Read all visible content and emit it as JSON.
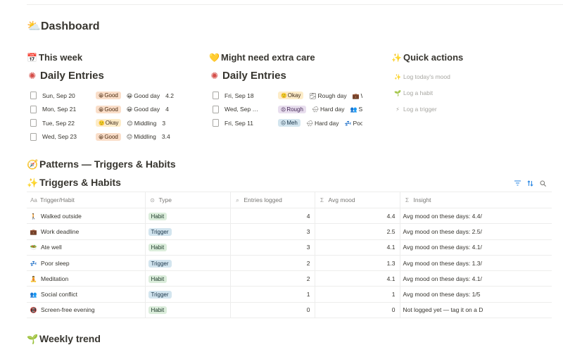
{
  "dashboard": {
    "icon": "⛅",
    "title": "Dashboard"
  },
  "colors": {
    "good_bg": "#fadec9",
    "good_text": "#49290e",
    "okay_bg": "#fdecc8",
    "okay_text": "#402c1b",
    "rough_bg": "#e8deee",
    "rough_text": "#412454",
    "meh_bg": "#d3e5ef",
    "meh_text": "#183347",
    "habit_bg": "#dbeddb",
    "trigger_bg": "#d3e5ef"
  },
  "this_week": {
    "icon": "📅",
    "heading": "This week",
    "view_icon": "✺",
    "view_title": "Daily Entries",
    "rows": [
      {
        "date": "Sun, Sep 20",
        "mood": "Good",
        "mood_icon": "😀",
        "day": "Good day",
        "day_icon": "😀",
        "score": "4.2"
      },
      {
        "date": "Mon, Sep 21",
        "mood": "Good",
        "mood_icon": "😀",
        "day": "Good day",
        "day_icon": "😀",
        "score": "4"
      },
      {
        "date": "Tue, Sep 22",
        "mood": "Okay",
        "mood_icon": "🙂",
        "day": "Middling",
        "day_icon": "😐",
        "score": "3"
      },
      {
        "date": "Wed, Sep 23",
        "mood": "Good",
        "mood_icon": "😀",
        "day": "Middling",
        "day_icon": "😐",
        "score": "3.4"
      }
    ]
  },
  "extra_care": {
    "icon": "💛",
    "heading": "Might need extra care",
    "view_icon": "✺",
    "view_title": "Daily Entries",
    "rows": [
      {
        "date": "Fri, Sep 18",
        "mood": "Okay",
        "mood_icon": "🙂",
        "day": "Rough day",
        "day_icon": "🌫",
        "tag": "Wor",
        "tag_icon": "💼"
      },
      {
        "date": "Wed, Sep …",
        "mood": "Rough",
        "mood_icon": "😣",
        "day": "Hard day",
        "day_icon": "🌧",
        "tag": "Soci",
        "tag_icon": "👥"
      },
      {
        "date": "Fri, Sep 11",
        "mood": "Meh",
        "mood_icon": "😐",
        "day": "Hard day",
        "day_icon": "🌧",
        "tag": "Poor s",
        "tag_icon": "💤"
      }
    ]
  },
  "quick_actions": {
    "icon": "✨",
    "heading": "Quick actions",
    "items": [
      {
        "icon": "✨",
        "label": "Log today's mood"
      },
      {
        "icon": "🌱",
        "label": "Log a habit"
      },
      {
        "icon": "⚡",
        "label": "Log a trigger"
      }
    ]
  },
  "patterns": {
    "icon": "🧭",
    "title": "Patterns — Triggers & Habits"
  },
  "triggers_habits": {
    "icon": "✨",
    "title": "Triggers & Habits",
    "toolbar": {
      "filter": "filter-icon",
      "sort": "sort-icon",
      "search": "search-icon"
    },
    "columns": [
      {
        "icon": "Aa",
        "label": "Trigger/Habit"
      },
      {
        "icon": "⊙",
        "label": "Type"
      },
      {
        "icon": "⌕",
        "label": "Entries logged"
      },
      {
        "icon": "Σ",
        "label": "Avg mood"
      },
      {
        "icon": "Σ",
        "label": "Insight"
      }
    ],
    "rows": [
      {
        "icon": "🚶",
        "name": "Walked outside",
        "type": "Habit",
        "entries": "4",
        "avg": "4.4",
        "insight": "Avg mood on these days: 4.4/"
      },
      {
        "icon": "💼",
        "name": "Work deadline",
        "type": "Trigger",
        "entries": "3",
        "avg": "2.5",
        "insight": "Avg mood on these days: 2.5/"
      },
      {
        "icon": "🥗",
        "name": "Ate well",
        "type": "Habit",
        "entries": "3",
        "avg": "4.1",
        "insight": "Avg mood on these days: 4.1/"
      },
      {
        "icon": "💤",
        "name": "Poor sleep",
        "type": "Trigger",
        "entries": "2",
        "avg": "1.3",
        "insight": "Avg mood on these days: 1.3/"
      },
      {
        "icon": "🧘",
        "name": "Meditation",
        "type": "Habit",
        "entries": "2",
        "avg": "4.1",
        "insight": "Avg mood on these days: 4.1/"
      },
      {
        "icon": "👥",
        "name": "Social conflict",
        "type": "Trigger",
        "entries": "1",
        "avg": "1",
        "insight": "Avg mood on these days: 1/5"
      },
      {
        "icon": "📵",
        "name": "Screen-free evening",
        "type": "Habit",
        "entries": "0",
        "avg": "0",
        "insight": "Not logged yet — tag it on a D"
      }
    ]
  },
  "weekly_trend": {
    "icon": "🌱",
    "title": "Weekly trend"
  }
}
